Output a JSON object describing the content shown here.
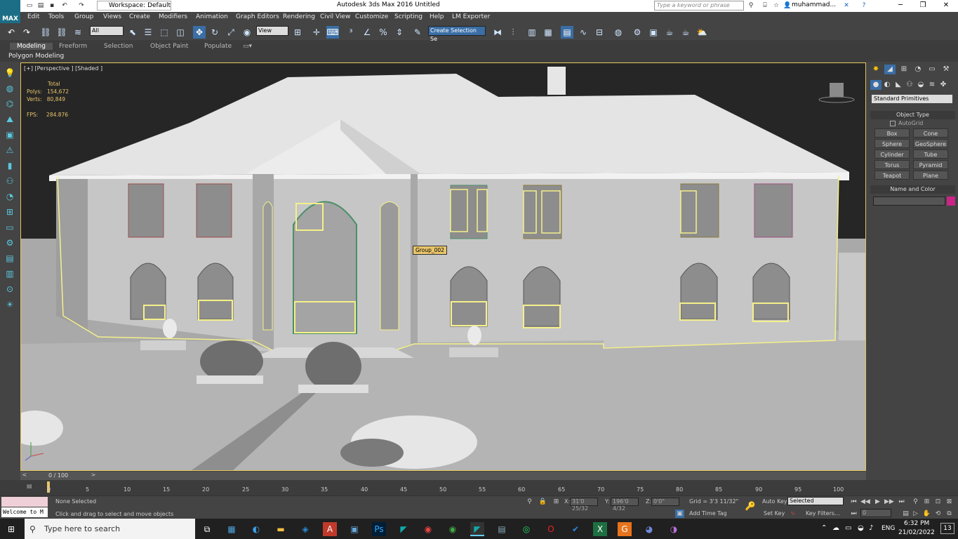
{
  "titlebar": {
    "workspace": "Workspace: Default",
    "title": "Autodesk 3ds Max 2016     Untitled",
    "search_placeholder": "Type a keyword or phrase",
    "user": "muhammad..."
  },
  "logo": "MAX",
  "menu": [
    "Edit",
    "Tools",
    "Group",
    "Views",
    "Create",
    "Modifiers",
    "Animation",
    "Graph Editors",
    "Rendering",
    "Civil View",
    "Customize",
    "Scripting",
    "Help",
    "LM Exporter"
  ],
  "toolbar": {
    "filter": "All",
    "ref_coord": "View",
    "selection_set": "Create Selection Se"
  },
  "ribbon": {
    "tabs": [
      "Modeling",
      "Freeform",
      "Selection",
      "Object Paint",
      "Populate"
    ],
    "active_tab": "Modeling",
    "sub_label": "Polygon Modeling"
  },
  "viewport": {
    "label": "[+] [Perspective ] [Shaded ]",
    "stats": {
      "total_label": "Total",
      "polys_label": "Polys:",
      "polys": "154,672",
      "verts_label": "Verts:",
      "verts": "80,849",
      "fps_label": "FPS:",
      "fps": "284.876"
    },
    "tooltip": "Group_002",
    "highlight_color": "#f5f08a"
  },
  "command_panel": {
    "category": "Standard Primitives",
    "object_type_header": "Object Type",
    "autogrid": "AutoGrid",
    "buttons": [
      "Box",
      "Cone",
      "Sphere",
      "GeoSphere",
      "Cylinder",
      "Tube",
      "Torus",
      "Pyramid",
      "Teapot",
      "Plane"
    ],
    "name_color_header": "Name and Color",
    "object_color": "#c92486"
  },
  "timeline": {
    "frame_label": "0 / 100",
    "ticks": [
      "0",
      "5",
      "10",
      "15",
      "20",
      "25",
      "30",
      "35",
      "40",
      "45",
      "50",
      "55",
      "60",
      "65",
      "70",
      "75",
      "80",
      "85",
      "90",
      "95",
      "100"
    ]
  },
  "status": {
    "maxscript": "Welcome to M",
    "selection": "None Selected",
    "prompt": "Click and drag to select and move objects",
    "x_label": "X:",
    "x_value": "31'0 25/32",
    "y_label": "Y:",
    "y_value": "196'0 4/32",
    "z_label": "Z:",
    "z_value": "0'0\"",
    "grid": "Grid = 3'3 11/32\"",
    "add_time_tag": "Add Time Tag",
    "auto_key": "Auto Key",
    "set_key": "Set Key",
    "key_mode": "Selected",
    "key_filters": "Key Filters...",
    "frame": "0"
  },
  "taskbar": {
    "search": "Type here to search",
    "time": "6:32 PM",
    "date": "21/02/2022",
    "lang": "ENG",
    "notifications": "13"
  }
}
